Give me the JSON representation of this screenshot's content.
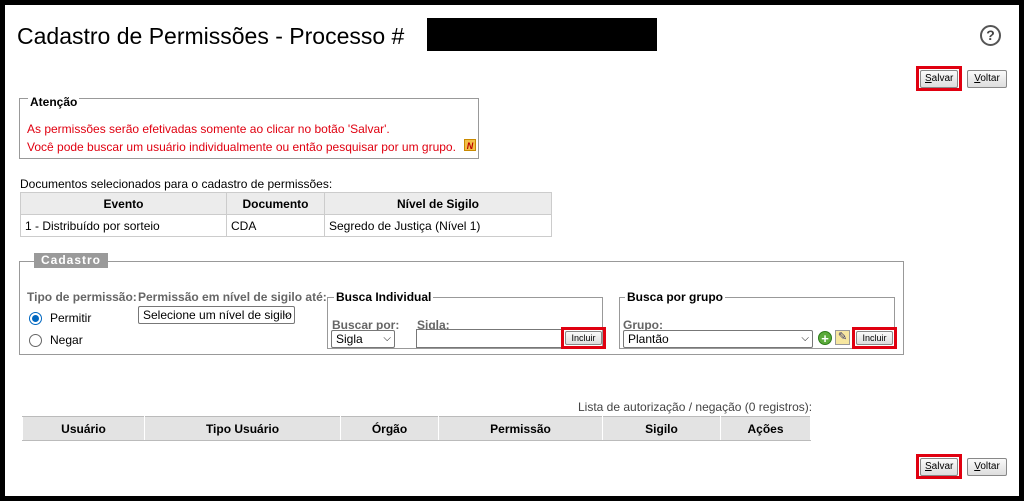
{
  "header": {
    "title": "Cadastro de Permissões - Processo #",
    "help_icon": "question-circle-icon",
    "help_glyph": "?"
  },
  "toolbar": {
    "save_letter": "S",
    "save_rest": "alvar",
    "back_letter": "V",
    "back_rest": "oltar"
  },
  "attention": {
    "legend": "Atenção",
    "line1": "As permissões serão efetivadas somente ao clicar no botão 'Salvar'.",
    "line2": "Você pode buscar um usuário individualmente ou então pesquisar por um grupo.",
    "note_icon": "N"
  },
  "documents": {
    "caption": "Documentos selecionados para o cadastro de permissões:",
    "headers": [
      "Evento",
      "Documento",
      "Nível de Sigilo"
    ],
    "rows": [
      [
        "1 - Distribuído por sorteio",
        "CDA",
        "Segredo de Justiça (Nível 1)"
      ]
    ]
  },
  "cadastro": {
    "legend": "Cadastro",
    "tipo_label": "Tipo de permissão:",
    "permitir": "Permitir",
    "negar": "Negar",
    "nivel_label": "Permissão em nível de sigilo até:",
    "nivel_select": "Selecione um nível de sigilo",
    "busca_individual": {
      "legend": "Busca Individual",
      "buscar_por_label": "Buscar por:",
      "buscar_por_value": "Sigla",
      "sigla_label": "Sigla:",
      "sigla_value": "",
      "incluir": "Incluir"
    },
    "busca_grupo": {
      "legend": "Busca por grupo",
      "grupo_label": "Grupo:",
      "grupo_value": "Plantão",
      "incluir": "Incluir"
    }
  },
  "list": {
    "caption": "Lista de autorização / negação (0 registros):",
    "headers": [
      "Usuário",
      "Tipo Usuário",
      "Órgão",
      "Permissão",
      "Sigilo",
      "Ações"
    ]
  },
  "colors": {
    "highlight": "#e00010",
    "warning_text": "#e00010"
  }
}
